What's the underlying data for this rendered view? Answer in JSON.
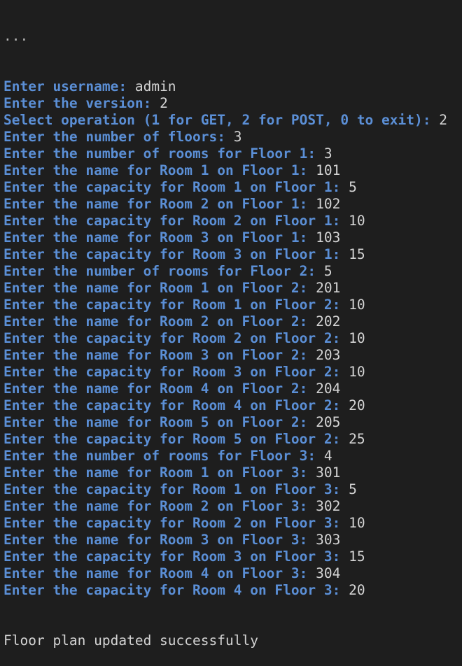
{
  "terminal": {
    "colors": {
      "background": "#1e1e1e",
      "prompt": "#5b8fd6",
      "text": "#d4d4d4"
    },
    "clipped_top_line": "...",
    "lines": [
      {
        "prompt": "Enter username: ",
        "value": "admin"
      },
      {
        "prompt": "Enter the version: ",
        "value": "2"
      },
      {
        "prompt": "Select operation (1 for GET, 2 for POST, 0 to exit): ",
        "value": "2"
      },
      {
        "prompt": "Enter the number of floors: ",
        "value": "3"
      },
      {
        "prompt": "Enter the number of rooms for Floor 1: ",
        "value": "3"
      },
      {
        "prompt": "Enter the name for Room 1 on Floor 1: ",
        "value": "101"
      },
      {
        "prompt": "Enter the capacity for Room 1 on Floor 1: ",
        "value": "5"
      },
      {
        "prompt": "Enter the name for Room 2 on Floor 1: ",
        "value": "102"
      },
      {
        "prompt": "Enter the capacity for Room 2 on Floor 1: ",
        "value": "10"
      },
      {
        "prompt": "Enter the name for Room 3 on Floor 1: ",
        "value": "103"
      },
      {
        "prompt": "Enter the capacity for Room 3 on Floor 1: ",
        "value": "15"
      },
      {
        "prompt": "Enter the number of rooms for Floor 2: ",
        "value": "5"
      },
      {
        "prompt": "Enter the name for Room 1 on Floor 2: ",
        "value": "201"
      },
      {
        "prompt": "Enter the capacity for Room 1 on Floor 2: ",
        "value": "10"
      },
      {
        "prompt": "Enter the name for Room 2 on Floor 2: ",
        "value": "202"
      },
      {
        "prompt": "Enter the capacity for Room 2 on Floor 2: ",
        "value": "10"
      },
      {
        "prompt": "Enter the name for Room 3 on Floor 2: ",
        "value": "203"
      },
      {
        "prompt": "Enter the capacity for Room 3 on Floor 2: ",
        "value": "10"
      },
      {
        "prompt": "Enter the name for Room 4 on Floor 2: ",
        "value": "204"
      },
      {
        "prompt": "Enter the capacity for Room 4 on Floor 2: ",
        "value": "20"
      },
      {
        "prompt": "Enter the name for Room 5 on Floor 2: ",
        "value": "205"
      },
      {
        "prompt": "Enter the capacity for Room 5 on Floor 2: ",
        "value": "25"
      },
      {
        "prompt": "Enter the number of rooms for Floor 3: ",
        "value": "4"
      },
      {
        "prompt": "Enter the name for Room 1 on Floor 3: ",
        "value": "301"
      },
      {
        "prompt": "Enter the capacity for Room 1 on Floor 3: ",
        "value": "5"
      },
      {
        "prompt": "Enter the name for Room 2 on Floor 3: ",
        "value": "302"
      },
      {
        "prompt": "Enter the capacity for Room 2 on Floor 3: ",
        "value": "10"
      },
      {
        "prompt": "Enter the name for Room 3 on Floor 3: ",
        "value": "303"
      },
      {
        "prompt": "Enter the capacity for Room 3 on Floor 3: ",
        "value": "15"
      },
      {
        "prompt": "Enter the name for Room 4 on Floor 3: ",
        "value": "304"
      },
      {
        "prompt": "Enter the capacity for Room 4 on Floor 3: ",
        "value": "20"
      }
    ],
    "final_message": "Floor plan updated successfully"
  }
}
